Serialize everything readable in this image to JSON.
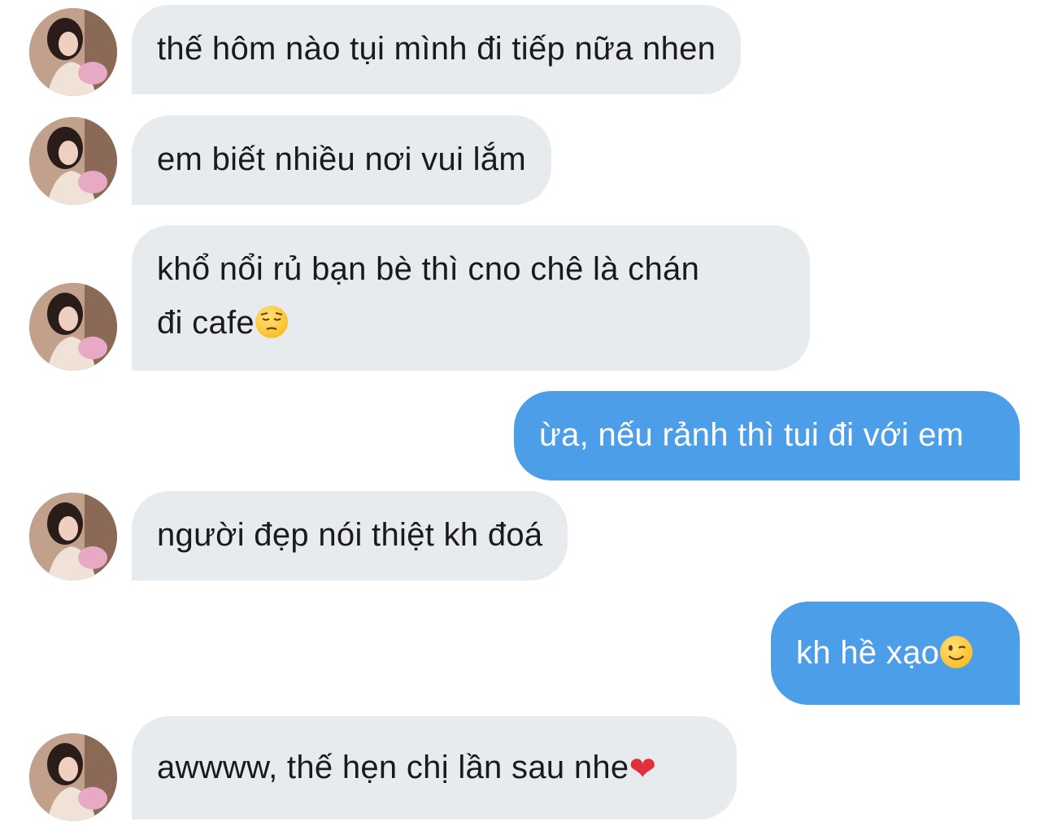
{
  "messages": [
    {
      "sender": "other",
      "text": "thế hôm nào tụi mình đi tiếp nữa nhen"
    },
    {
      "sender": "other",
      "text": "em biết nhiều nơi vui lắm"
    },
    {
      "sender": "other",
      "line1": "khổ nổi rủ bạn bè thì cno chê là chán",
      "line2": "đi cafe",
      "emoji": "pensive-face-emoji"
    },
    {
      "sender": "me",
      "text": "ừa, nếu rảnh thì tui đi với em"
    },
    {
      "sender": "other",
      "text": "người đẹp nói thiệt kh đoá"
    },
    {
      "sender": "me",
      "text": "kh hề xạo",
      "emoji": "winking-face-emoji"
    },
    {
      "sender": "other",
      "text": "awwww, thế hẹn chị lần sau nhe",
      "emoji": "red-heart-emoji"
    }
  ],
  "colors": {
    "incoming_bubble": "#e8ebee",
    "outgoing_bubble": "#4d9ee8",
    "incoming_text": "#1a1a1a",
    "outgoing_text": "#ffffff"
  },
  "icons": {
    "avatar": "contact-avatar",
    "heart": "❤"
  }
}
